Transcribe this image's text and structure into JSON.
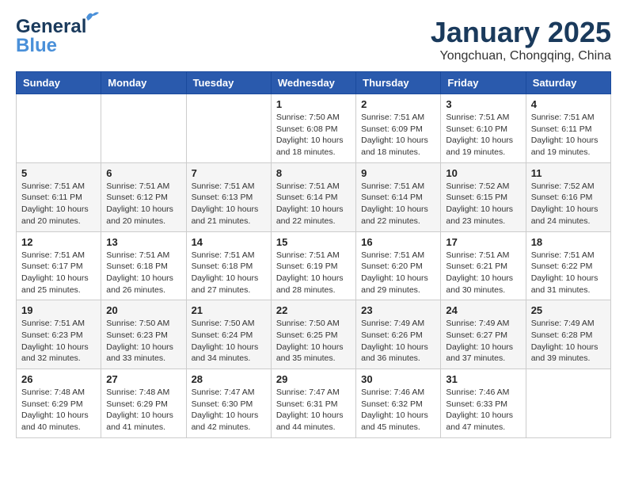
{
  "header": {
    "logo_line1": "General",
    "logo_line2": "Blue",
    "month": "January 2025",
    "location": "Yongchuan, Chongqing, China"
  },
  "weekdays": [
    "Sunday",
    "Monday",
    "Tuesday",
    "Wednesday",
    "Thursday",
    "Friday",
    "Saturday"
  ],
  "weeks": [
    [
      {
        "day": "",
        "sunrise": "",
        "sunset": "",
        "daylight": ""
      },
      {
        "day": "",
        "sunrise": "",
        "sunset": "",
        "daylight": ""
      },
      {
        "day": "",
        "sunrise": "",
        "sunset": "",
        "daylight": ""
      },
      {
        "day": "1",
        "sunrise": "Sunrise: 7:50 AM",
        "sunset": "Sunset: 6:08 PM",
        "daylight": "Daylight: 10 hours and 18 minutes."
      },
      {
        "day": "2",
        "sunrise": "Sunrise: 7:51 AM",
        "sunset": "Sunset: 6:09 PM",
        "daylight": "Daylight: 10 hours and 18 minutes."
      },
      {
        "day": "3",
        "sunrise": "Sunrise: 7:51 AM",
        "sunset": "Sunset: 6:10 PM",
        "daylight": "Daylight: 10 hours and 19 minutes."
      },
      {
        "day": "4",
        "sunrise": "Sunrise: 7:51 AM",
        "sunset": "Sunset: 6:11 PM",
        "daylight": "Daylight: 10 hours and 19 minutes."
      }
    ],
    [
      {
        "day": "5",
        "sunrise": "Sunrise: 7:51 AM",
        "sunset": "Sunset: 6:11 PM",
        "daylight": "Daylight: 10 hours and 20 minutes."
      },
      {
        "day": "6",
        "sunrise": "Sunrise: 7:51 AM",
        "sunset": "Sunset: 6:12 PM",
        "daylight": "Daylight: 10 hours and 20 minutes."
      },
      {
        "day": "7",
        "sunrise": "Sunrise: 7:51 AM",
        "sunset": "Sunset: 6:13 PM",
        "daylight": "Daylight: 10 hours and 21 minutes."
      },
      {
        "day": "8",
        "sunrise": "Sunrise: 7:51 AM",
        "sunset": "Sunset: 6:14 PM",
        "daylight": "Daylight: 10 hours and 22 minutes."
      },
      {
        "day": "9",
        "sunrise": "Sunrise: 7:51 AM",
        "sunset": "Sunset: 6:14 PM",
        "daylight": "Daylight: 10 hours and 22 minutes."
      },
      {
        "day": "10",
        "sunrise": "Sunrise: 7:52 AM",
        "sunset": "Sunset: 6:15 PM",
        "daylight": "Daylight: 10 hours and 23 minutes."
      },
      {
        "day": "11",
        "sunrise": "Sunrise: 7:52 AM",
        "sunset": "Sunset: 6:16 PM",
        "daylight": "Daylight: 10 hours and 24 minutes."
      }
    ],
    [
      {
        "day": "12",
        "sunrise": "Sunrise: 7:51 AM",
        "sunset": "Sunset: 6:17 PM",
        "daylight": "Daylight: 10 hours and 25 minutes."
      },
      {
        "day": "13",
        "sunrise": "Sunrise: 7:51 AM",
        "sunset": "Sunset: 6:18 PM",
        "daylight": "Daylight: 10 hours and 26 minutes."
      },
      {
        "day": "14",
        "sunrise": "Sunrise: 7:51 AM",
        "sunset": "Sunset: 6:18 PM",
        "daylight": "Daylight: 10 hours and 27 minutes."
      },
      {
        "day": "15",
        "sunrise": "Sunrise: 7:51 AM",
        "sunset": "Sunset: 6:19 PM",
        "daylight": "Daylight: 10 hours and 28 minutes."
      },
      {
        "day": "16",
        "sunrise": "Sunrise: 7:51 AM",
        "sunset": "Sunset: 6:20 PM",
        "daylight": "Daylight: 10 hours and 29 minutes."
      },
      {
        "day": "17",
        "sunrise": "Sunrise: 7:51 AM",
        "sunset": "Sunset: 6:21 PM",
        "daylight": "Daylight: 10 hours and 30 minutes."
      },
      {
        "day": "18",
        "sunrise": "Sunrise: 7:51 AM",
        "sunset": "Sunset: 6:22 PM",
        "daylight": "Daylight: 10 hours and 31 minutes."
      }
    ],
    [
      {
        "day": "19",
        "sunrise": "Sunrise: 7:51 AM",
        "sunset": "Sunset: 6:23 PM",
        "daylight": "Daylight: 10 hours and 32 minutes."
      },
      {
        "day": "20",
        "sunrise": "Sunrise: 7:50 AM",
        "sunset": "Sunset: 6:23 PM",
        "daylight": "Daylight: 10 hours and 33 minutes."
      },
      {
        "day": "21",
        "sunrise": "Sunrise: 7:50 AM",
        "sunset": "Sunset: 6:24 PM",
        "daylight": "Daylight: 10 hours and 34 minutes."
      },
      {
        "day": "22",
        "sunrise": "Sunrise: 7:50 AM",
        "sunset": "Sunset: 6:25 PM",
        "daylight": "Daylight: 10 hours and 35 minutes."
      },
      {
        "day": "23",
        "sunrise": "Sunrise: 7:49 AM",
        "sunset": "Sunset: 6:26 PM",
        "daylight": "Daylight: 10 hours and 36 minutes."
      },
      {
        "day": "24",
        "sunrise": "Sunrise: 7:49 AM",
        "sunset": "Sunset: 6:27 PM",
        "daylight": "Daylight: 10 hours and 37 minutes."
      },
      {
        "day": "25",
        "sunrise": "Sunrise: 7:49 AM",
        "sunset": "Sunset: 6:28 PM",
        "daylight": "Daylight: 10 hours and 39 minutes."
      }
    ],
    [
      {
        "day": "26",
        "sunrise": "Sunrise: 7:48 AM",
        "sunset": "Sunset: 6:29 PM",
        "daylight": "Daylight: 10 hours and 40 minutes."
      },
      {
        "day": "27",
        "sunrise": "Sunrise: 7:48 AM",
        "sunset": "Sunset: 6:29 PM",
        "daylight": "Daylight: 10 hours and 41 minutes."
      },
      {
        "day": "28",
        "sunrise": "Sunrise: 7:47 AM",
        "sunset": "Sunset: 6:30 PM",
        "daylight": "Daylight: 10 hours and 42 minutes."
      },
      {
        "day": "29",
        "sunrise": "Sunrise: 7:47 AM",
        "sunset": "Sunset: 6:31 PM",
        "daylight": "Daylight: 10 hours and 44 minutes."
      },
      {
        "day": "30",
        "sunrise": "Sunrise: 7:46 AM",
        "sunset": "Sunset: 6:32 PM",
        "daylight": "Daylight: 10 hours and 45 minutes."
      },
      {
        "day": "31",
        "sunrise": "Sunrise: 7:46 AM",
        "sunset": "Sunset: 6:33 PM",
        "daylight": "Daylight: 10 hours and 47 minutes."
      },
      {
        "day": "",
        "sunrise": "",
        "sunset": "",
        "daylight": ""
      }
    ]
  ]
}
